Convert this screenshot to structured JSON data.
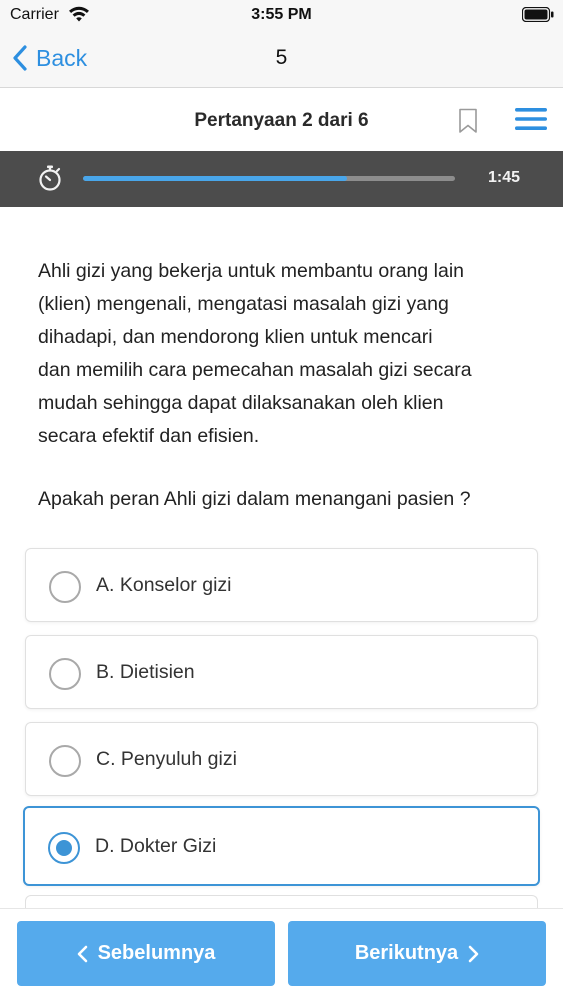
{
  "status_bar": {
    "carrier": "Carrier",
    "time": "3:55 PM"
  },
  "nav": {
    "back_label": "Back",
    "title": "5"
  },
  "question_header": {
    "counter": "Pertanyaan 2 dari 6"
  },
  "timer": {
    "progress_fraction": 0.71,
    "time_left": "1:45"
  },
  "question": {
    "body_lines": [
      "Ahli gizi yang bekerja untuk membantu orang lain",
      "(klien) mengenali, mengatasi masalah gizi yang",
      "dihadapi, dan mendorong klien untuk mencari",
      "dan memilih cara pemecahan masalah gizi secara",
      "mudah sehingga dapat dilaksanakan oleh klien",
      "secara efektif dan efisien."
    ],
    "prompt": "Apakah peran Ahli gizi dalam menangani pasien ?"
  },
  "options": [
    {
      "label": "A. Konselor gizi",
      "selected": false
    },
    {
      "label": "B. Dietisien",
      "selected": false
    },
    {
      "label": "C. Penyuluh gizi",
      "selected": false
    },
    {
      "label": "D. Dokter Gizi",
      "selected": true
    }
  ],
  "footer": {
    "prev_label": "Sebelumnya",
    "next_label": "Berikutnya"
  },
  "colors": {
    "accent": "#3d94d6",
    "button": "#55aaec",
    "timer_background": "#4c4c4c",
    "progress": "#49a6ea"
  },
  "icons": {
    "back": "chevron-left-icon",
    "bookmark": "bookmark-icon",
    "menu": "hamburger-menu-icon",
    "timer": "stopwatch-icon"
  }
}
